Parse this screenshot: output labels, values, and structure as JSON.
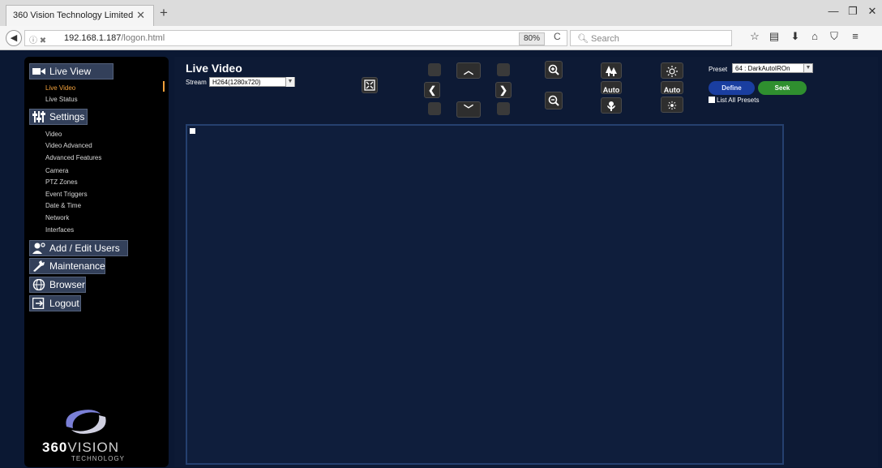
{
  "browser": {
    "tab_title": "360 Vision Technology Limited",
    "tab_close": "✕",
    "new_tab": "+",
    "url_host": "192.168.1.187",
    "url_path": "/logon.html",
    "zoom": "80%",
    "reload": "C",
    "search_placeholder": "Search",
    "window_minimize": "—",
    "window_restore": "❐",
    "window_close": "✕"
  },
  "sidebar": {
    "live_view": "Live View",
    "live_video": "Live Video",
    "live_status": "Live Status",
    "settings": "Settings",
    "settings_items": [
      "Video",
      "Video Advanced",
      "Advanced Features",
      "Camera",
      "PTZ Zones",
      "Event Triggers",
      "Date & Time",
      "Network",
      "Interfaces"
    ],
    "add_edit_users": "Add / Edit Users",
    "maintenance": "Maintenance",
    "browser": "Browser",
    "logout": "Logout",
    "logo_bold": "360",
    "logo_thin": "VISION",
    "logo_sub": "TECHNOLOGY"
  },
  "main": {
    "title": "Live Video",
    "stream_label": "Stream",
    "stream_value": "H264(1280x720)",
    "auto_focus": "Auto",
    "auto_iris": "Auto",
    "preset_label": "Preset",
    "preset_value": "64 : DarkAutoIROn",
    "define_label": "Define",
    "seek_label": "Seek",
    "list_all_presets": "List All Presets"
  },
  "colors": {
    "background": "#0b1833",
    "sidebar": "#000000",
    "active_item": "#f0a03c",
    "define_button": "#1a3ea0",
    "seek_button": "#2f8f2f"
  }
}
